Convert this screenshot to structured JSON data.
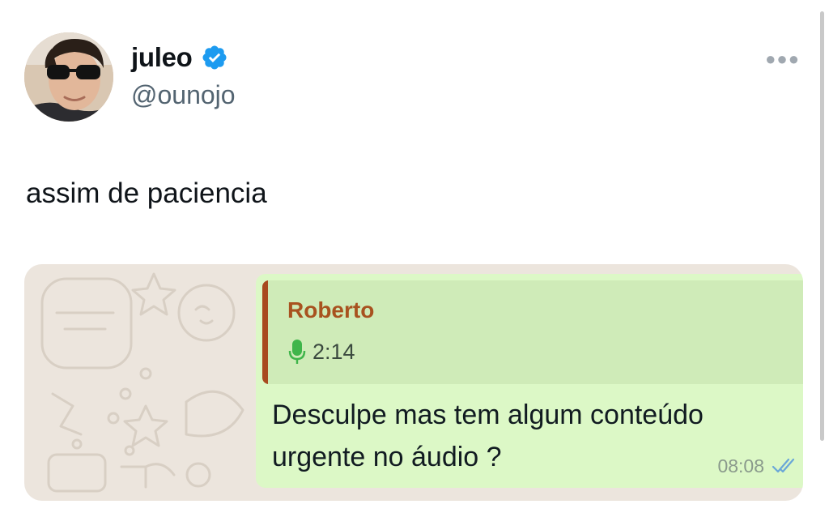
{
  "author": {
    "display_name": "juleo",
    "handle": "@ounojo",
    "verified": true,
    "verified_color": "#1d9bf0"
  },
  "tweet": {
    "text": "assim de paciencia"
  },
  "more_icon": "more-horizontal-icon",
  "media": {
    "reply": {
      "author": "Roberto",
      "audio_icon": "microphone-icon",
      "audio_duration": "2:14",
      "accent_color": "#a84a1f"
    },
    "message_lines": [
      "Desculpe mas tem algum conteúdo",
      "urgente no áudio ?"
    ],
    "time": "08:08",
    "status_icon": "double-check-icon",
    "bubble_color": "#dcf8c6"
  }
}
